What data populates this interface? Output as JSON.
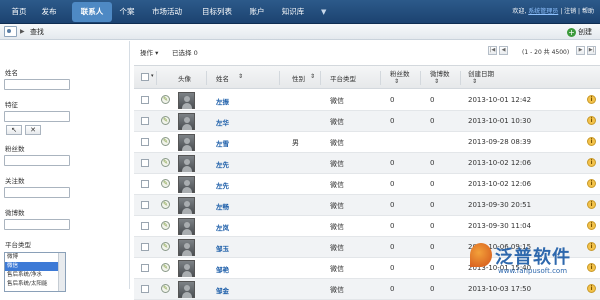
{
  "nav": {
    "items": [
      "首页",
      "发布",
      "联系人",
      "个案",
      "市场活动",
      "目标列表",
      "账户",
      "知识库"
    ],
    "active_index": 2,
    "more_icon": "chevron-down-icon",
    "welcome": "欢迎",
    "user": "系统管理员",
    "logout": "注销",
    "help": "帮助"
  },
  "subbar": {
    "title": "查找",
    "create": "创建",
    "icon": "contact-card-icon"
  },
  "filters": {
    "name_label": "姓名",
    "feature_label": "特征",
    "fans_label": "粉丝数",
    "follow_label": "关注数",
    "weibo_label": "微博数",
    "platform_label": "平台类型",
    "platform_options": [
      "微博",
      "微信",
      "售后系统/净水",
      "售后系统/太阳能"
    ],
    "platform_selected": 1
  },
  "toolbar": {
    "operation": "操作",
    "selected": "已选择 0",
    "pager_text": "(1 - 20 共 4500)"
  },
  "table": {
    "headers": [
      "头像",
      "姓名",
      "性别",
      "平台类型",
      "粉丝数",
      "微博数",
      "创建日期"
    ],
    "rows": [
      {
        "name": "左振",
        "gender": "",
        "platform": "微信",
        "fans": "0",
        "weibo": "0",
        "date": "2013-10-01 12:42"
      },
      {
        "name": "左华",
        "gender": "",
        "platform": "微信",
        "fans": "0",
        "weibo": "0",
        "date": "2013-10-01 10:30"
      },
      {
        "name": "左雪",
        "gender": "男",
        "platform": "微信",
        "fans": "",
        "weibo": "",
        "date": "2013-09-28 08:39"
      },
      {
        "name": "左先",
        "gender": "",
        "platform": "微信",
        "fans": "0",
        "weibo": "0",
        "date": "2013-10-02 12:06"
      },
      {
        "name": "左先",
        "gender": "",
        "platform": "微信",
        "fans": "0",
        "weibo": "0",
        "date": "2013-10-02 12:06"
      },
      {
        "name": "左畅",
        "gender": "",
        "platform": "微信",
        "fans": "0",
        "weibo": "0",
        "date": "2013-09-30 20:51"
      },
      {
        "name": "左岚",
        "gender": "",
        "platform": "微信",
        "fans": "0",
        "weibo": "0",
        "date": "2013-09-30 11:04"
      },
      {
        "name": "邹玉",
        "gender": "",
        "platform": "微信",
        "fans": "0",
        "weibo": "0",
        "date": "2013-10-06 09:15"
      },
      {
        "name": "邹艳",
        "gender": "",
        "platform": "微信",
        "fans": "0",
        "weibo": "0",
        "date": "2013-10-01 15:40"
      },
      {
        "name": "邹金",
        "gender": "",
        "platform": "微信",
        "fans": "0",
        "weibo": "0",
        "date": "2013-10-03 17:50"
      }
    ]
  },
  "watermark": {
    "text": "泛普软件",
    "url": "www.fanpusoft.com"
  }
}
